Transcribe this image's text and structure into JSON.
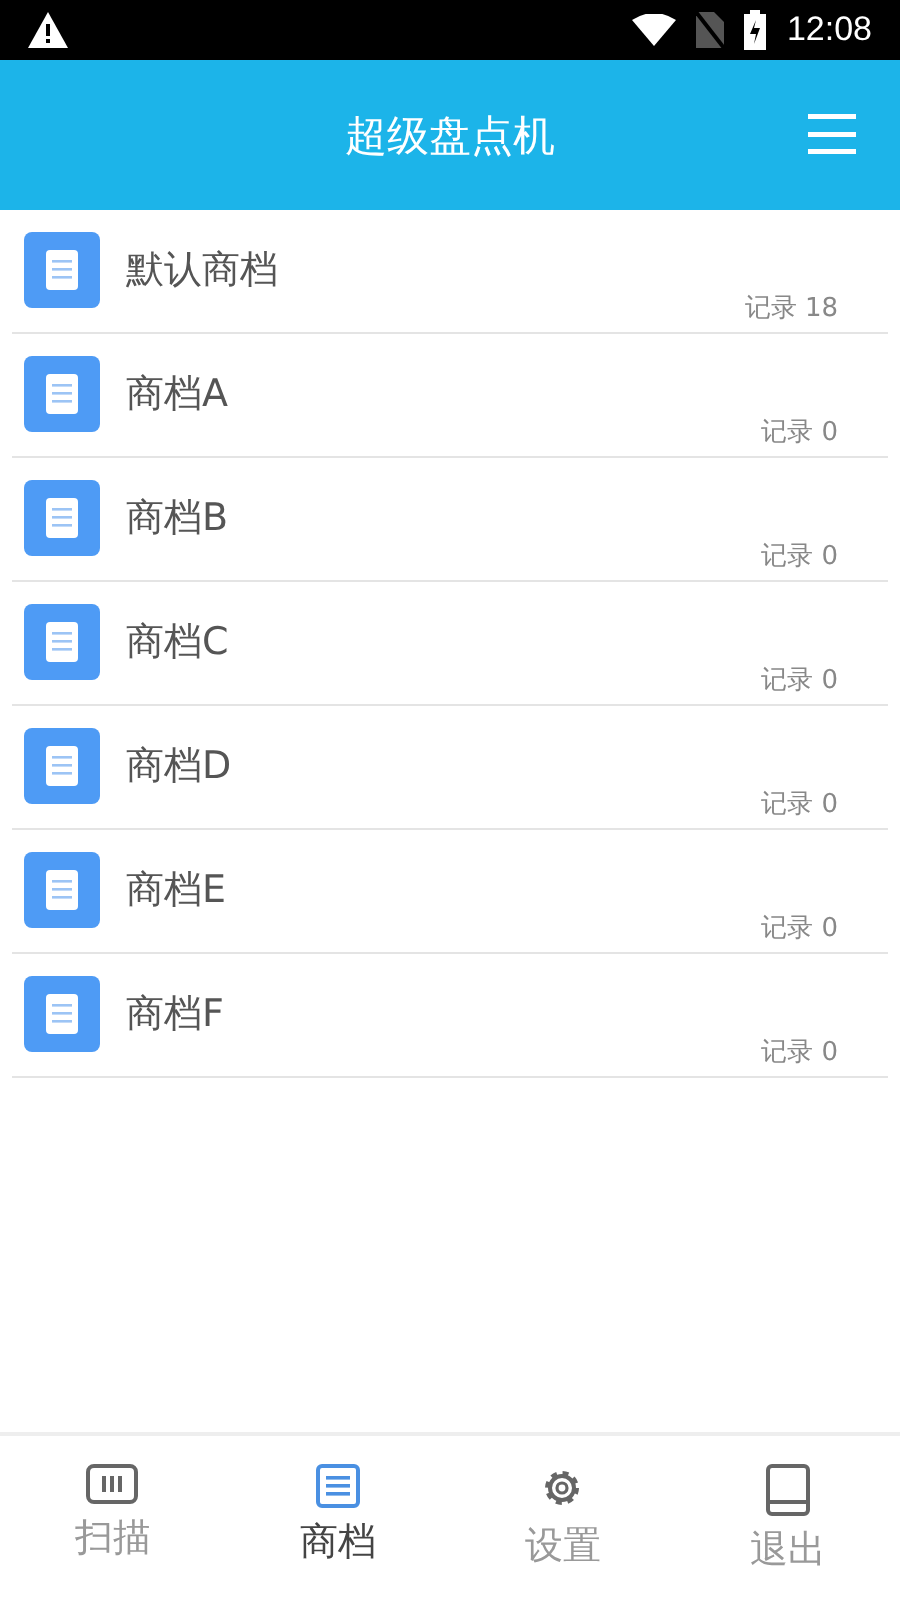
{
  "status_bar": {
    "time": "12:08"
  },
  "header": {
    "title": "超级盘点机"
  },
  "stores": [
    {
      "name": "默认商档",
      "records": "记录 18"
    },
    {
      "name": "商档A",
      "records": "记录 0"
    },
    {
      "name": "商档B",
      "records": "记录 0"
    },
    {
      "name": "商档C",
      "records": "记录 0"
    },
    {
      "name": "商档D",
      "records": "记录 0"
    },
    {
      "name": "商档E",
      "records": "记录 0"
    },
    {
      "name": "商档F",
      "records": "记录 0"
    }
  ],
  "tabs": [
    {
      "kind": "scan",
      "label": "扫描",
      "selected": false
    },
    {
      "kind": "list",
      "label": "商档",
      "selected": true
    },
    {
      "kind": "settings",
      "label": "设置",
      "selected": false
    },
    {
      "kind": "exit",
      "label": "退出",
      "selected": false
    }
  ]
}
